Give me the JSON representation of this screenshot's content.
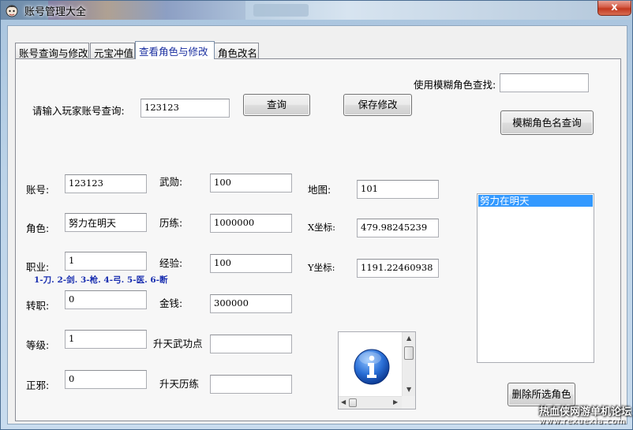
{
  "window": {
    "title": "账号管理大全",
    "close_glyph": "x"
  },
  "tabs": [
    {
      "label": "账号查询与修改"
    },
    {
      "label": "元宝冲值"
    },
    {
      "label": "查看角色与修改"
    },
    {
      "label": "角色改名"
    }
  ],
  "query": {
    "account_label": "请输入玩家账号查询:",
    "account_value": "123123",
    "query_button": "查询",
    "save_button": "保存修改",
    "fuzzy_label": "使用模糊角色查找:",
    "fuzzy_value": "",
    "fuzzy_button": "模糊角色名查询"
  },
  "fields": {
    "account": {
      "label": "账号:",
      "value": "123123"
    },
    "role": {
      "label": "角色:",
      "value": "努力在明天"
    },
    "job": {
      "label": "职业:",
      "value": "1"
    },
    "job_hint": "1-刀. 2-剑. 3-枪. 4-弓. 5-医. 6-断",
    "transfer": {
      "label": "转职:",
      "value": "0"
    },
    "level": {
      "label": "等级:",
      "value": "1"
    },
    "alignment": {
      "label": "正邪:",
      "value": "0"
    },
    "merit": {
      "label": "武勋:",
      "value": "100"
    },
    "experience_pts": {
      "label": "历练:",
      "value": "1000000"
    },
    "exp": {
      "label": "经验:",
      "value": "100"
    },
    "money": {
      "label": "金钱:",
      "value": "300000"
    },
    "ascend_skill": {
      "label": "升天武功点",
      "value": ""
    },
    "ascend_exp": {
      "label": "升天历练",
      "value": ""
    },
    "map": {
      "label": "地图:",
      "value": "101"
    },
    "x": {
      "label": "X坐标:",
      "value": "479.98245239"
    },
    "y": {
      "label": "Y坐标:",
      "value": "1191.22460938"
    }
  },
  "role_list": {
    "items": [
      "努力在明天"
    ],
    "selected": "努力在明天"
  },
  "delete_button": "删除所选角色",
  "icons": {
    "info": "info-icon"
  },
  "watermark": {
    "line1": "热血侠网游单机论坛",
    "line2": "www.rexuexia.com"
  }
}
